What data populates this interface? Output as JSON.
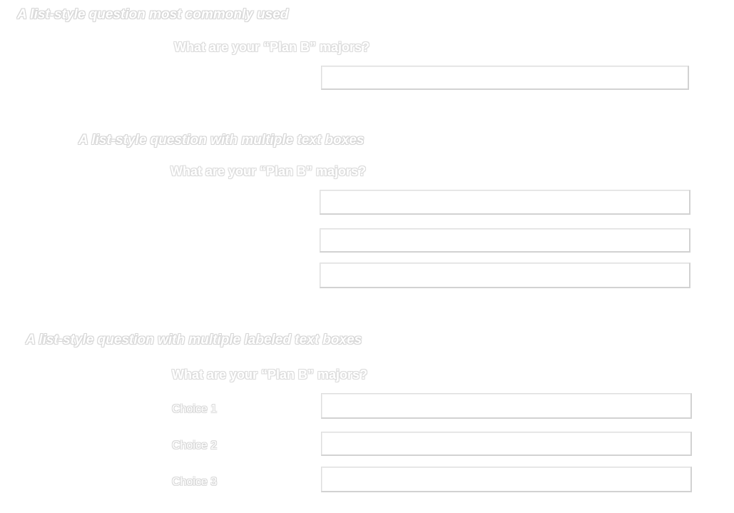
{
  "sections": [
    {
      "title": "A list-style question most commonly used",
      "question": "What are your “Plan B” majors?",
      "inputs": [
        {
          "value": "",
          "placeholder": ""
        }
      ]
    },
    {
      "title": "A list-style question with multiple text boxes",
      "question": "What are your “Plan B” majors?",
      "inputs": [
        {
          "value": "",
          "placeholder": ""
        },
        {
          "value": "",
          "placeholder": ""
        },
        {
          "value": "",
          "placeholder": ""
        }
      ]
    },
    {
      "title": "A list-style question with multiple labeled text boxes",
      "question": "What are your “Plan B” majors?",
      "choices": [
        {
          "label": "Choice 1",
          "value": "",
          "placeholder": ""
        },
        {
          "label": "Choice 2",
          "value": "",
          "placeholder": ""
        },
        {
          "label": "Choice 3",
          "value": "",
          "placeholder": ""
        }
      ]
    }
  ],
  "colors": {
    "background": "#ffffff",
    "text_outline": "#d6d6d6",
    "input_border": "#dedede"
  }
}
